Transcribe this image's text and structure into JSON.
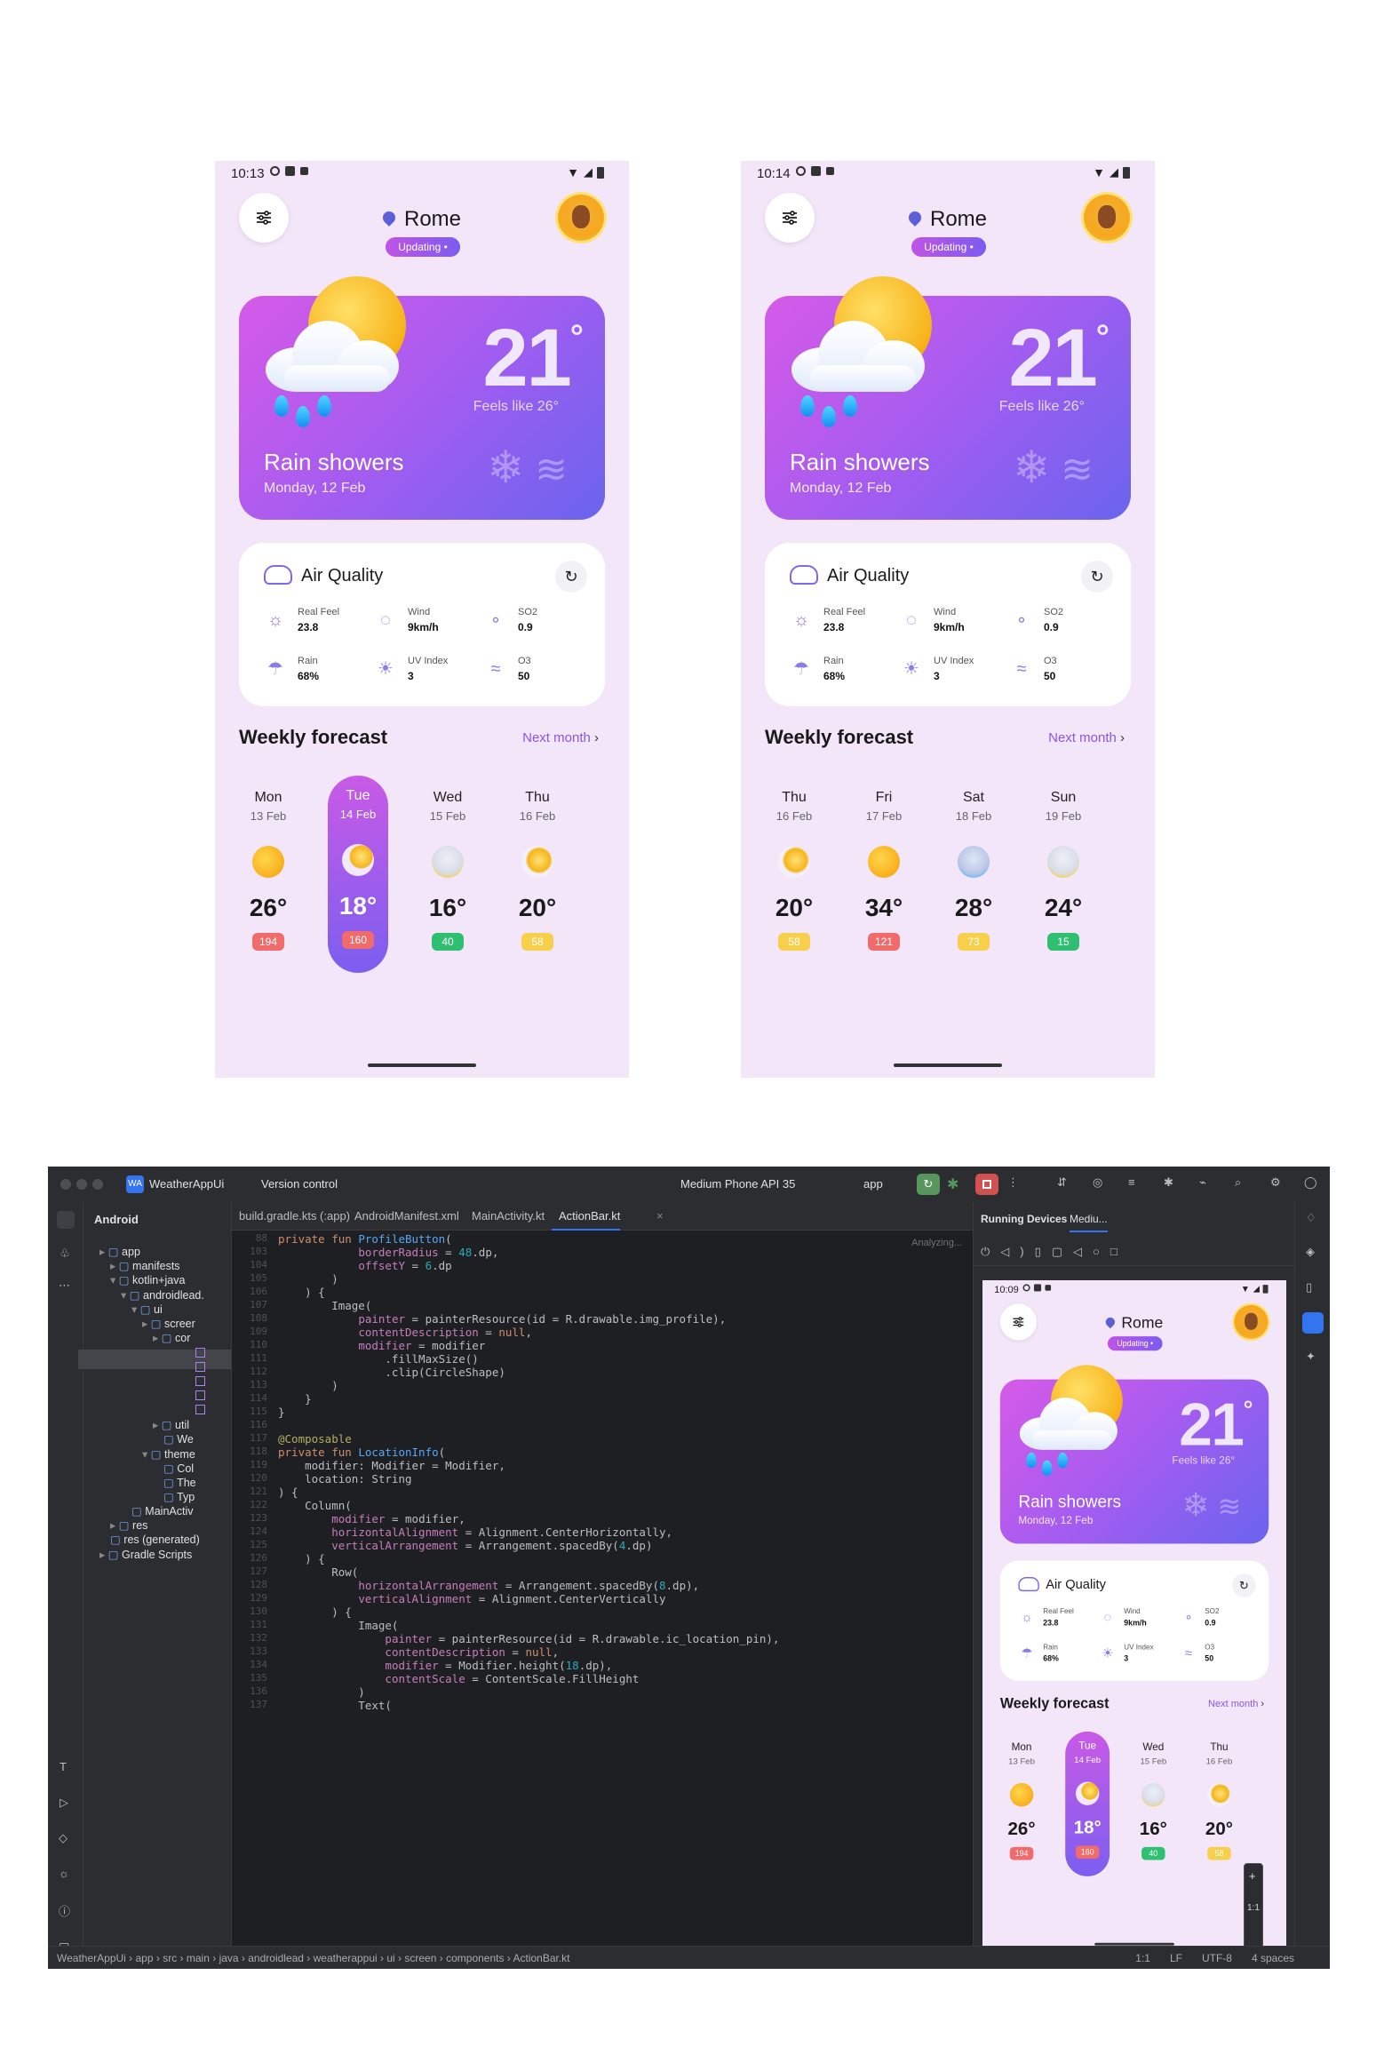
{
  "phones": [
    {
      "time": "10:13",
      "city": "Rome",
      "status": "Updating •",
      "temp": "21",
      "deg": "°",
      "feels": "Feels like 26°",
      "condition": "Rain showers",
      "date": "Monday, 12 Feb",
      "aq_title": "Air Quality",
      "metrics": [
        {
          "label": "Real Feel",
          "value": "23.8"
        },
        {
          "label": "Wind",
          "value": "9km/h"
        },
        {
          "label": "SO2",
          "value": "0.9"
        },
        {
          "label": "Rain",
          "value": "68%"
        },
        {
          "label": "UV Index",
          "value": "3"
        },
        {
          "label": "O3",
          "value": "50"
        }
      ],
      "weekly_title": "Weekly forecast",
      "next_label": "Next month",
      "days": [
        {
          "name": "Mon",
          "date": "13 Feb",
          "temp": "26°",
          "aqi": "194",
          "color": "#f26b6b",
          "icon": "sun-icon",
          "selected": false
        },
        {
          "name": "Tue",
          "date": "14 Feb",
          "temp": "18°",
          "aqi": "160",
          "color": "#f26b6b",
          "icon": "cloud-sun-icon",
          "selected": true
        },
        {
          "name": "Wed",
          "date": "15 Feb",
          "temp": "16°",
          "aqi": "40",
          "color": "#2fbf71",
          "icon": "storm-icon",
          "selected": false
        },
        {
          "name": "Thu",
          "date": "16 Feb",
          "temp": "20°",
          "aqi": "58",
          "color": "#f7cf4a",
          "icon": "sun-cloud-icon",
          "selected": false
        }
      ]
    },
    {
      "time": "10:14",
      "city": "Rome",
      "status": "Updating •",
      "temp": "21",
      "deg": "°",
      "feels": "Feels like 26°",
      "condition": "Rain showers",
      "date": "Monday, 12 Feb",
      "aq_title": "Air Quality",
      "metrics": [
        {
          "label": "Real Feel",
          "value": "23.8"
        },
        {
          "label": "Wind",
          "value": "9km/h"
        },
        {
          "label": "SO2",
          "value": "0.9"
        },
        {
          "label": "Rain",
          "value": "68%"
        },
        {
          "label": "UV Index",
          "value": "3"
        },
        {
          "label": "O3",
          "value": "50"
        }
      ],
      "weekly_title": "Weekly forecast",
      "next_label": "Next month",
      "days": [
        {
          "name": "Thu",
          "date": "16 Feb",
          "temp": "20°",
          "aqi": "58",
          "color": "#f7cf4a",
          "icon": "sun-cloud-icon",
          "selected": false
        },
        {
          "name": "Fri",
          "date": "17 Feb",
          "temp": "34°",
          "aqi": "121",
          "color": "#f26b6b",
          "icon": "sun-icon",
          "selected": false
        },
        {
          "name": "Sat",
          "date": "18 Feb",
          "temp": "28°",
          "aqi": "73",
          "color": "#f7cf4a",
          "icon": "rain-cloud-icon",
          "selected": false
        },
        {
          "name": "Sun",
          "date": "19 Feb",
          "temp": "24°",
          "aqi": "15",
          "color": "#2fbf71",
          "icon": "storm-icon",
          "selected": false
        }
      ]
    }
  ],
  "ide": {
    "project_badge": "WA",
    "project_name": "WeatherAppUi",
    "vcs": "Version control",
    "device": "Medium Phone API 35",
    "run_config": "app",
    "view_mode": "Android",
    "tree": [
      "app",
      "manifests",
      "kotlin+java",
      "androidlead.",
      "ui",
      "screer",
      "cor",
      "util",
      "We",
      "theme",
      "Col",
      "The",
      "Typ",
      "MainActiv",
      "res",
      "res (generated)",
      "Gradle Scripts"
    ],
    "tabs": [
      "build.gradle.kts (:app)",
      "AndroidManifest.xml",
      "MainActivity.kt",
      "ActionBar.kt"
    ],
    "analyzing": "Analyzing...",
    "code_first_line": "private fun ProfileButton(",
    "line_numbers": [
      "88",
      "103",
      "104",
      "105",
      "106",
      "107",
      "108",
      "109",
      "110",
      "111",
      "112",
      "113",
      "114",
      "115",
      "116",
      "117",
      "118",
      "119",
      "120",
      "121",
      "122",
      "123",
      "124",
      "125",
      "126",
      "127",
      "128",
      "129",
      "130",
      "131",
      "132",
      "133",
      "134",
      "135",
      "136",
      "137"
    ],
    "code_lines": [
      "private fun ProfileButton(",
      "            borderRadius = 48.dp,",
      "            offsetY = 6.dp",
      "        )",
      "    ) {",
      "        Image(",
      "            painter = painterResource(id = R.drawable.img_profile),",
      "            contentDescription = null,",
      "            modifier = modifier",
      "                .fillMaxSize()",
      "                .clip(CircleShape)",
      "        )",
      "    }",
      "}",
      "",
      "@Composable",
      "private fun LocationInfo(",
      "    modifier: Modifier = Modifier,",
      "    location: String",
      ") {",
      "    Column(",
      "        modifier = modifier,",
      "        horizontalAlignment = Alignment.CenterHorizontally,",
      "        verticalArrangement = Arrangement.spacedBy(4.dp)",
      "    ) {",
      "        Row(",
      "            horizontalArrangement = Arrangement.spacedBy(8.dp),",
      "            verticalAlignment = Alignment.CenterVertically",
      "        ) {",
      "            Image(",
      "                painter = painterResource(id = R.drawable.ic_location_pin),",
      "                contentDescription = null,",
      "                modifier = Modifier.height(18.dp),",
      "                contentScale = ContentScale.FillHeight",
      "            )",
      "            Text("
    ],
    "running_devices": "Running Devices",
    "device_tab": "Mediu...",
    "mini_time": "10:09",
    "breadcrumbs": [
      "WeatherAppUi",
      "app",
      "src",
      "main",
      "java",
      "androidlead",
      "weatherappui",
      "ui",
      "screen",
      "components",
      "ActionBar.kt"
    ],
    "status_right": [
      "1:1",
      "LF",
      "UTF-8",
      "4 spaces"
    ],
    "zoom_label": "1:1"
  }
}
